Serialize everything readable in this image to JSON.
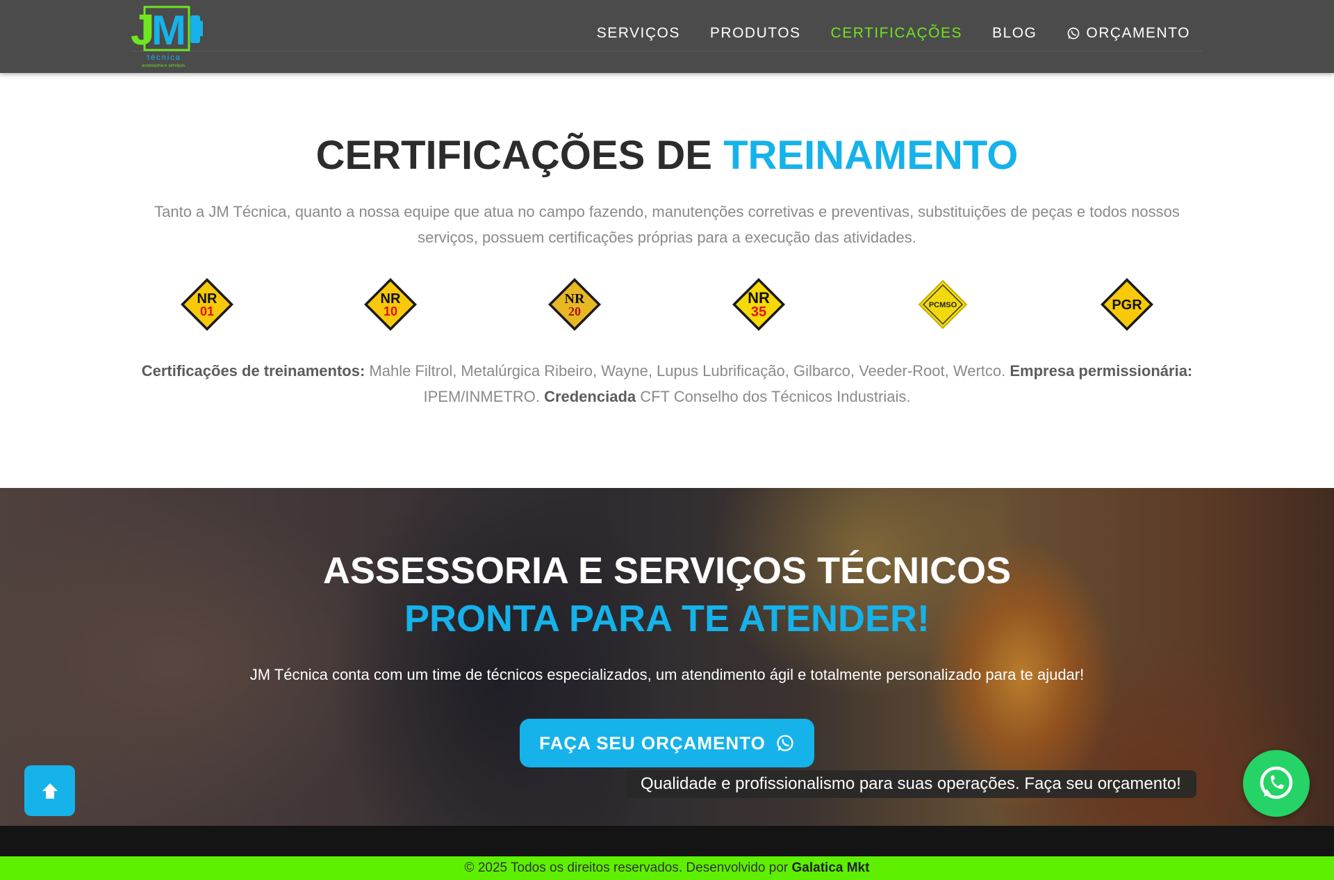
{
  "header": {
    "logo_text": "JM técnica assessoria e serviços",
    "nav": [
      {
        "label": "SERVIÇOS"
      },
      {
        "label": "PRODUTOS"
      },
      {
        "label": "CERTIFICAÇÕES"
      },
      {
        "label": "BLOG"
      },
      {
        "label": "ORÇAMENTO",
        "icon": "whatsapp-icon"
      }
    ]
  },
  "certifications": {
    "title_part1": "CERTIFICAÇÕES DE",
    "title_part2": "TREINAMENTO",
    "description": "Tanto a JM Técnica, quanto a nossa equipe que atua no campo fazendo, manutenções corretivas e preventivas, substituições de peças e todos nossos serviços, possuem certificações próprias para a execução das atividades.",
    "badges": [
      {
        "line1": "NR",
        "line2": "01"
      },
      {
        "line1": "NR",
        "line2": "10"
      },
      {
        "line1": "NR",
        "line2": "20"
      },
      {
        "line1": "NR",
        "line2": "35"
      },
      {
        "line1": "PCMSO",
        "line2": ""
      },
      {
        "line1": "PGR",
        "line2": ""
      }
    ],
    "info_label1": "Certificações de treinamentos:",
    "info_text1": " Mahle Filtrol, Metalúrgica Ribeiro, Wayne, Lupus Lubrificação, Gilbarco, Veeder-Root, Wertco. ",
    "info_label2": "Empresa permissionária:",
    "info_text2": " IPEM/INMETRO. ",
    "info_label3": "Credenciada",
    "info_text3": " CFT Conselho dos Técnicos Industriais."
  },
  "hero": {
    "title_line1": "ASSESSORIA E SERVIÇOS TÉCNICOS",
    "title_line2": "PRONTA PARA TE ATENDER!",
    "description": "JM Técnica conta com um time de técnicos especializados, um atendimento ágil e totalmente personalizado para te ajudar!",
    "cta_label": "FAÇA SEU ORÇAMENTO"
  },
  "floating": {
    "whatsapp_tooltip": "Qualidade e profissionalismo para suas operações. Faça seu orçamento!"
  },
  "footer": {
    "copyright": "© 2025 Todos os direitos reservados. Desenvolvido por ",
    "developer": "Galatica Mkt"
  },
  "colors": {
    "accent_blue": "#16b2ea",
    "accent_green": "#6ee620",
    "header_bg": "#4b4b4b",
    "footer_green": "#5ef000",
    "whatsapp_green": "#25d366"
  }
}
